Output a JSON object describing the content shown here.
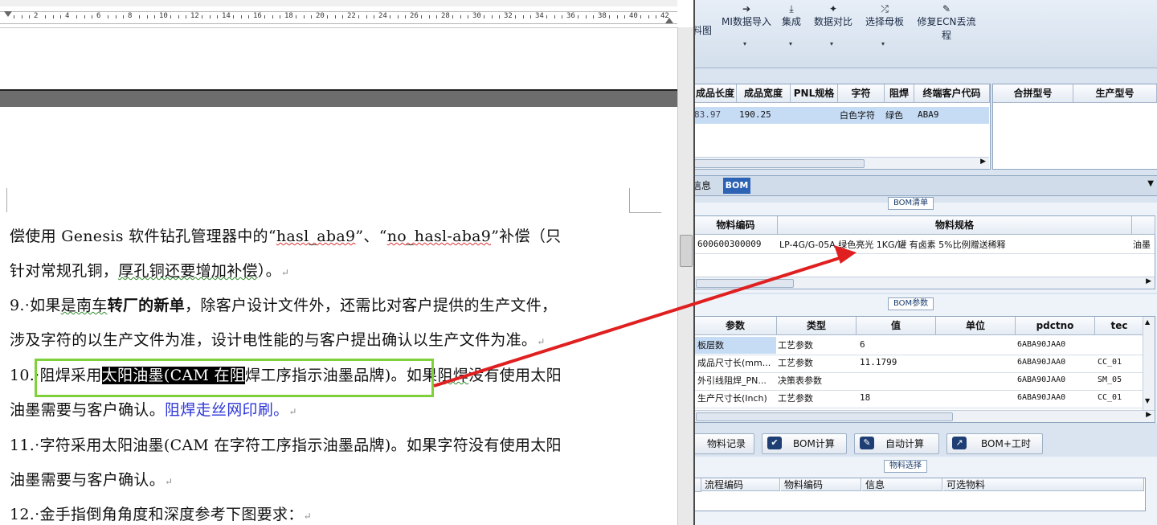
{
  "word": {
    "ruler": {
      "numbers": [
        "2",
        "4",
        "6",
        "8",
        "10",
        "12",
        "14",
        "16",
        "18",
        "20",
        "22",
        "24",
        "26",
        "28",
        "30",
        "32",
        "34",
        "36",
        "38",
        "40",
        "42"
      ]
    },
    "lines": {
      "l1_a": "偿使用 Genesis 软件钻孔管理器中的“",
      "l1_b": "hasl_aba9",
      "l1_c": "”、“",
      "l1_d": "no_hasl-aba9",
      "l1_e": "”补偿（只",
      "l2_a": "针对常规孔铜，",
      "l2_b": "厚孔铜还要增加补偿",
      "l2_c": "）。",
      "l3_a": "9.·如果",
      "l3_b": "是南车",
      "l3_c": "转厂的新单",
      "l3_d": "，除客户设计文件外，还需比对客户提供的生产文件，",
      "l4_a": "涉及字符的以生产文件为准，设计电性能的与客户提出确认以生产文件为准。",
      "l5_a": "10.·阻焊采用",
      "l5_sel": "太阳油墨(CAM 在阻",
      "l5_b": "焊工序指示油墨品牌)。如果",
      "l5_c": "阻焊",
      "l5_d": "没有使用太阳",
      "l6_a": "油墨需要与客户确认。",
      "l6_b": "阻焊走丝网印刷。",
      "l7_a": "11.·字符采用太阳油墨(CAM 在字符工序指示油墨品牌)。如果字符没有使用太阳",
      "l8_a": "油墨需要与客户确认。",
      "l9_a": "12.·金手指倒角角度和深度参考下图要求：",
      "mark": "↵"
    }
  },
  "erp": {
    "toolbar": [
      {
        "label": "料图",
        "icon": "chart-icon"
      },
      {
        "label": "MI数据导入",
        "icon": "import-icon"
      },
      {
        "label": "集成",
        "icon": "download-icon"
      },
      {
        "label": "数据对比",
        "icon": "compare-icon"
      },
      {
        "label": "选择母板",
        "icon": "shuffle-icon"
      },
      {
        "label": "修复ECN丢流程",
        "icon": "wrench-icon"
      }
    ],
    "top_grid": {
      "headers": [
        "成品长度",
        "成品宽度",
        "PNL规格",
        "字符",
        "阻焊",
        "终端客户代码"
      ],
      "row": [
        "83.97",
        "190.25",
        "",
        "白色字符",
        "绿色",
        "ABA9"
      ]
    },
    "side_grid": {
      "headers": [
        "合拼型号",
        "生产型号"
      ]
    },
    "tabs": [
      {
        "label": "信息"
      },
      {
        "label": "BOM"
      }
    ],
    "bom_list": {
      "group": "BOM清单",
      "headers": [
        "物料编码",
        "物料规格"
      ],
      "row": [
        "600600300009",
        "LP-4G/G-05A 绿色亮光 1KG/罐 有卤素 5%比例赠送稀释",
        "油墨"
      ]
    },
    "bom_params": {
      "group": "BOM参数",
      "headers": [
        "参数",
        "类型",
        "值",
        "单位",
        "pdctno",
        "tec"
      ],
      "rows": [
        [
          "板层数",
          "工艺参数",
          "6",
          "",
          "6ABA90JAA0",
          ""
        ],
        [
          "成品尺寸长(mm...",
          "工艺参数",
          "11.1799",
          "",
          "6ABA90JAA0",
          "CC_01"
        ],
        [
          "外引线阻焊_PN...",
          "决策表参数",
          "",
          "",
          "6ABA90JAA0",
          "SM_05"
        ],
        [
          "生产尺寸长(Inch)",
          "工艺参数",
          "18",
          "",
          "6ABA90JAA0",
          "CC_01"
        ]
      ]
    },
    "buttons": [
      {
        "label": "物料记录"
      },
      {
        "label": "BOM计算"
      },
      {
        "label": "自动计算"
      },
      {
        "label": "BOM+工时"
      }
    ],
    "material_select": {
      "group": "物料选择",
      "headers": [
        "流程编码",
        "物料编码",
        "信息",
        "可选物料"
      ]
    }
  },
  "colors": {
    "highlight_box": "#7fd13b",
    "arrow": "#e02020",
    "selection_row": "#c6dcf5",
    "link_blue": "#2d36d8"
  }
}
